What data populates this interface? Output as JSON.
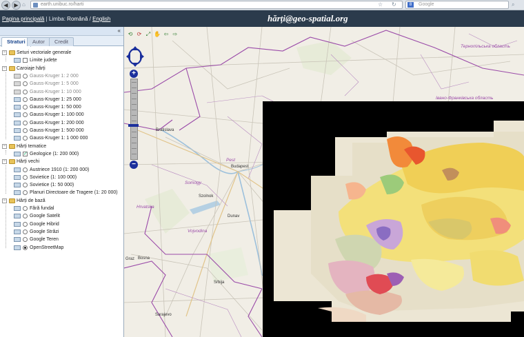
{
  "browser": {
    "url": "earth.unibuc.ro/harti",
    "search_placeholder": "Google",
    "search_engine_letter": "8",
    "back": "◀",
    "forward": "▶",
    "reload": "↻",
    "star": "☆",
    "search_go": "⌕",
    "home": "⌂"
  },
  "header": {
    "home_link": "Pagina principală",
    "language_label": "Limba:",
    "lang_ro": "Română",
    "lang_sep": "/",
    "lang_en": "English",
    "title": "hărți@geo-spatial.org"
  },
  "panel": {
    "collapse": "«",
    "tabs": [
      {
        "label": "Straturi",
        "active": true
      },
      {
        "label": "Autor",
        "active": false
      },
      {
        "label": "Credit",
        "active": false
      }
    ],
    "groups": [
      {
        "label": "Seturi vectoriale generale",
        "items": [
          {
            "label": "Limite județe",
            "control": "checkbox",
            "checked": false,
            "dim": false
          }
        ]
      },
      {
        "label": "Caroiaje hărți",
        "items": [
          {
            "label": "Gauss-Kruger 1: 2 000",
            "control": "radio",
            "checked": false,
            "dim": true
          },
          {
            "label": "Gauss-Kruger 1: 5 000",
            "control": "radio",
            "checked": false,
            "dim": true
          },
          {
            "label": "Gauss-Kruger 1: 10 000",
            "control": "radio",
            "checked": false,
            "dim": true
          },
          {
            "label": "Gauss-Kruger 1: 25 000",
            "control": "radio",
            "checked": false,
            "dim": false
          },
          {
            "label": "Gauss-Kruger 1: 50 000",
            "control": "radio",
            "checked": false,
            "dim": false
          },
          {
            "label": "Gauss-Kruger 1: 100 000",
            "control": "radio",
            "checked": false,
            "dim": false
          },
          {
            "label": "Gauss-Kruger 1: 200 000",
            "control": "radio",
            "checked": false,
            "dim": false
          },
          {
            "label": "Gauss-Kruger 1: 500 000",
            "control": "radio",
            "checked": false,
            "dim": false
          },
          {
            "label": "Gauss-Kruger 1: 1 000 000",
            "control": "radio",
            "checked": false,
            "dim": false
          }
        ]
      },
      {
        "label": "Hărți tematice",
        "items": [
          {
            "label": "Geologice (1: 200 000)",
            "control": "checkbox",
            "checked": true,
            "dim": false
          }
        ]
      },
      {
        "label": "Hărți vechi",
        "items": [
          {
            "label": "Austriece 1910 (1: 200 000)",
            "control": "radio",
            "checked": false,
            "dim": false
          },
          {
            "label": "Sovietice (1: 100 000)",
            "control": "radio",
            "checked": false,
            "dim": false
          },
          {
            "label": "Sovietice (1: 50 000)",
            "control": "radio",
            "checked": false,
            "dim": false
          },
          {
            "label": "Planuri Directoare de Tragere (1: 20 000)",
            "control": "radio",
            "checked": false,
            "dim": false
          }
        ]
      },
      {
        "label": "Hărți de bază",
        "items": [
          {
            "label": "Fără fundal",
            "control": "radio",
            "checked": false,
            "dim": false
          },
          {
            "label": "Google Satelit",
            "control": "radio",
            "checked": false,
            "dim": false
          },
          {
            "label": "Google Hibrid",
            "control": "radio",
            "checked": false,
            "dim": false
          },
          {
            "label": "Google Străzi",
            "control": "radio",
            "checked": false,
            "dim": false
          },
          {
            "label": "Google Teren",
            "control": "radio",
            "checked": false,
            "dim": false
          },
          {
            "label": "OpenStreetMap",
            "control": "radio",
            "checked": true,
            "dim": false
          }
        ]
      }
    ]
  },
  "map": {
    "labels": {
      "region_ternopil": "Тернопільська область",
      "region_ivano": "Івано-Франківська область",
      "bratislava": "Bratislava",
      "budapest": "Budapest",
      "vojvodina": "Vojvodina",
      "hrvatska": "Hrvatska",
      "srbija": "Srbija",
      "bosna": "Bosna",
      "dunav": "Dunav",
      "pest": "Pest",
      "somogy": "Somogy",
      "szolnok": "Szolnok",
      "graz": "Graz",
      "sarajevo": "Sarajevo"
    },
    "toolbar": [
      "⟲",
      "⟳",
      "⤢",
      "✋",
      "⇦",
      "⇨"
    ],
    "zoom_in": "+",
    "zoom_out": "−",
    "colors": {
      "overlay_border": "#000000",
      "border_purple": "#9a4aa8",
      "road": "#c9c4b8"
    }
  }
}
